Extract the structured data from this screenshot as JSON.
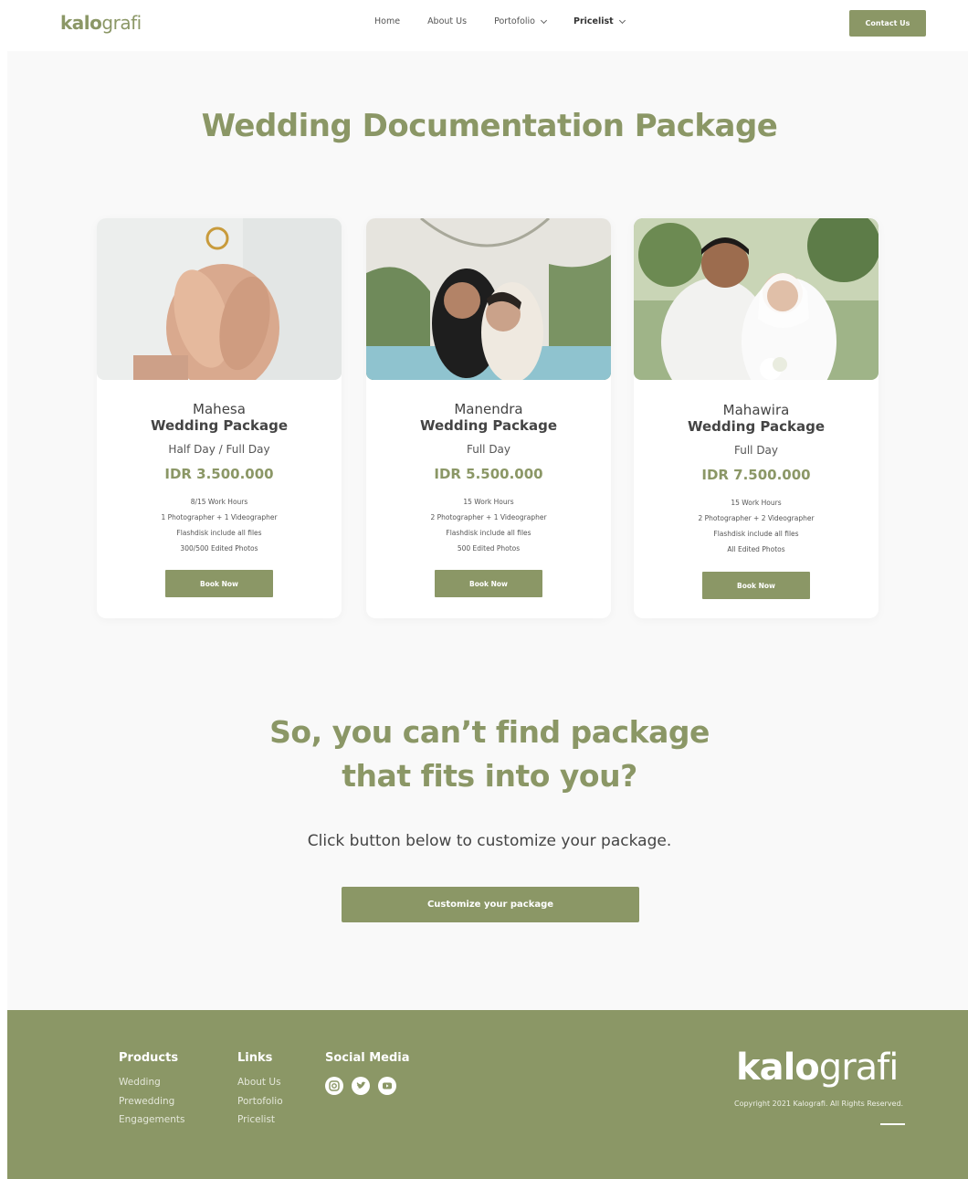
{
  "nav": {
    "logo_bold": "kalo",
    "logo_rest": "grafi",
    "links": [
      "Home",
      "About Us",
      "Portofolio",
      "Pricelist"
    ],
    "contact": "Contact Us"
  },
  "main": {
    "title": "Wedding Documentation Package",
    "packages": [
      {
        "name1": "Mahesa",
        "name2": "Wedding Package",
        "duration": "Half Day / Full Day",
        "price": "IDR 3.500.000",
        "features": [
          "8/15 Work Hours",
          "1 Photographer + 1 Videographer",
          "Flashdisk include all files",
          "300/500 Edited Photos"
        ],
        "button": "Book Now"
      },
      {
        "name1": "Manendra",
        "name2": "Wedding Package",
        "duration": "Full Day",
        "price": "IDR 5.500.000",
        "features": [
          "15 Work Hours",
          "2 Photographer + 1 Videographer",
          "Flashdisk include all files",
          "500 Edited Photos"
        ],
        "button": "Book Now"
      },
      {
        "name1": "Mahawira",
        "name2": "Wedding Package",
        "duration": "Full Day",
        "price": "IDR 7.500.000",
        "features": [
          "15 Work Hours",
          "2 Photographer + 2 Videographer",
          "Flashdisk include all files",
          "All Edited Photos"
        ],
        "button": "Book Now"
      }
    ],
    "cta_line1": "So, you can’t find package",
    "cta_line2": "that fits into you?",
    "cta_sub": "Click button below to customize your package.",
    "cta_button": "Customize your package"
  },
  "footer": {
    "products_head": "Products",
    "products": [
      "Wedding",
      "Prewedding",
      "Engagements"
    ],
    "links_head": "Links",
    "links": [
      "About Us",
      "Portofolio",
      "Pricelist"
    ],
    "social_head": "Social Media",
    "social_icons": [
      "instagram-icon",
      "twitter-icon",
      "youtube-icon"
    ],
    "logo_bold": "kalo",
    "logo_rest": "grafi",
    "copyright": "Copyright 2021 Kalografi. All Rights Reserved."
  },
  "colors": {
    "accent": "#8b9766",
    "background": "#f9f9f9"
  }
}
